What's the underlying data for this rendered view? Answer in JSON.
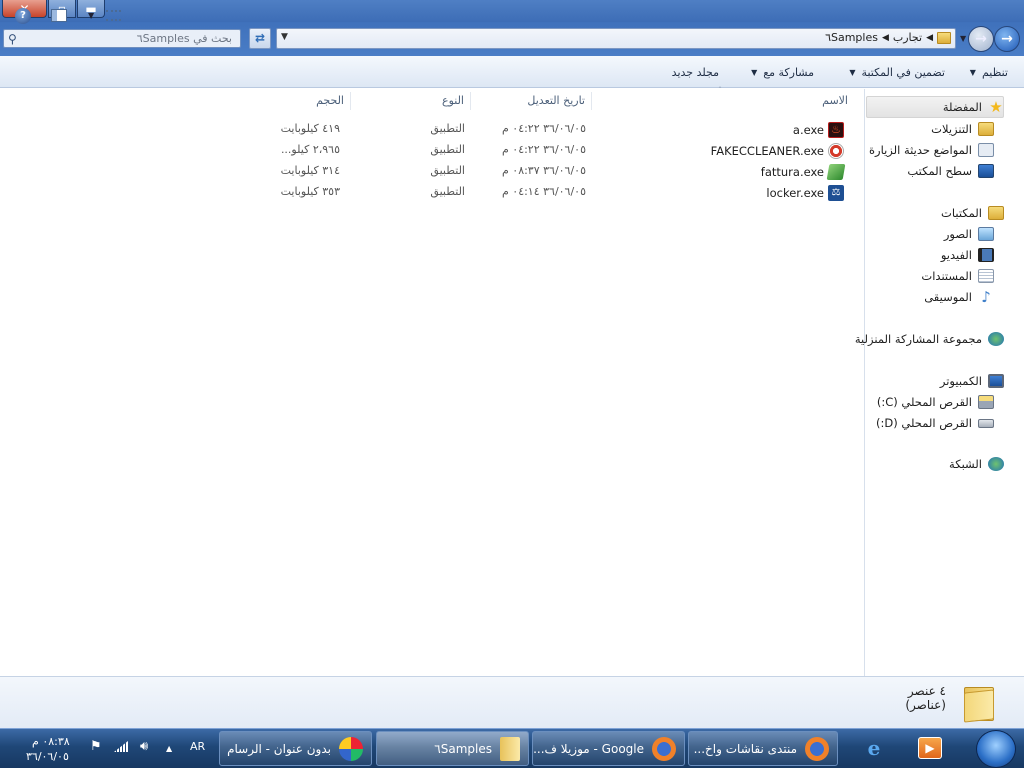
{
  "window": {
    "close": "✕",
    "maximize": "▫",
    "minimize": "▬"
  },
  "address": {
    "search_placeholder": "بحث في ٦Samples",
    "breadcrumbs": [
      "تجارب",
      "٦Samples"
    ]
  },
  "commands": {
    "organize": "تنظيم",
    "include": "تضمين في المكتبة",
    "share": "مشاركة مع",
    "new_folder": "مجلد جديد"
  },
  "columns": {
    "name": "الاسم",
    "date": "تاريخ التعديل",
    "type": "النوع",
    "size": "الحجم"
  },
  "files": [
    {
      "name": "a.exe",
      "date": "٣٦/٠٦/٠٥ ٠٤:٢٢ م",
      "type": "التطبيق",
      "size": "٤١٩ كيلوبايت",
      "icon": "red-flame-app-icon",
      "color": "#b91d1d"
    },
    {
      "name": "FAKECCLEANER.exe",
      "date": "٣٦/٠٦/٠٥ ٠٤:٢٢ م",
      "type": "التطبيق",
      "size": "٢،٩٦٥ كيلو...",
      "icon": "ccleaner-icon",
      "color": "#d43a2a"
    },
    {
      "name": "fattura.exe",
      "date": "٣٦/٠٦/٠٥ ٠٨:٣٧ م",
      "type": "التطبيق",
      "size": "٣١٤ كيلوبايت",
      "icon": "money-app-icon",
      "color": "#3a9a3a"
    },
    {
      "name": "locker.exe",
      "date": "٣٦/٠٦/٠٥ ٠٤:١٤ م",
      "type": "التطبيق",
      "size": "٣٥٣ كيلوبايت",
      "icon": "locker-app-icon",
      "color": "#1e4f93"
    }
  ],
  "nav": {
    "favorites": "المفضلة",
    "downloads": "التنزيلات",
    "recent": "المواضع حديثة الزيارة",
    "desktop": "سطح المكتب",
    "libraries": "المكتبات",
    "pictures": "الصور",
    "videos": "الفيديو",
    "documents": "المستندات",
    "music": "الموسيقى",
    "homegroup": "مجموعة المشاركة المنزلية",
    "computer": "الكمبيوتر",
    "drive_c": "القرص المحلي (C:)",
    "drive_d": "القرص المحلي (D:)",
    "network": "الشبكة"
  },
  "details": {
    "count": "٤ عنصر (عناصر)"
  },
  "taskbar": {
    "buttons": [
      {
        "label": "منتدى نقاشات واخ...",
        "icon": "firefox-icon"
      },
      {
        "label": "Google - موزيلا ف...",
        "icon": "firefox-icon"
      },
      {
        "label": "٦Samples",
        "icon": "folder-icon"
      },
      {
        "label": "بدون عنوان - الرسام",
        "icon": "paint-icon"
      }
    ],
    "lang": "AR",
    "time": "٠٨:٣٨ م",
    "date": "٣٦/٠٦/٠٥"
  }
}
